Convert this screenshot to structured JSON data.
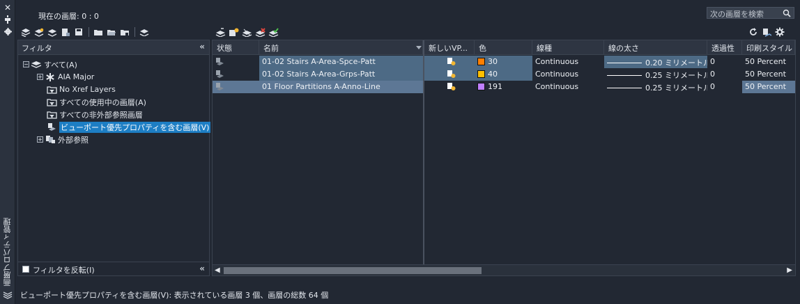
{
  "window": {
    "title": "画層プロパティ管理"
  },
  "header": {
    "current_layer": "現在の画層: 0 : 0",
    "search_placeholder": "次の画層を検索"
  },
  "toolbar_left": [
    "new-property-filter-icon",
    "new-group-filter-icon",
    "layer-states-manager-icon",
    "new-layer-icon",
    "new-vp-freeze-layer-icon",
    "delete-layer-icon",
    "set-current-icon",
    "folder-icon",
    "folder-open-icon",
    "folder-save-icon",
    "settings-layer-icon"
  ],
  "toolbar_right": [
    "refresh-icon",
    "layer-settings-icon",
    "gear-icon"
  ],
  "filter_panel": {
    "title": "フィルタ",
    "tree": [
      {
        "label": "すべて(A)",
        "expander": "−",
        "icon": "layers-stack-icon",
        "level": 0
      },
      {
        "label": "AIA Major",
        "expander": "+",
        "icon": "asterisk-filter-icon",
        "level": 1
      },
      {
        "label": "No Xref Layers",
        "expander": "",
        "icon": "property-filter-icon",
        "level": 1
      },
      {
        "label": "すべての使用中の画層(A)",
        "expander": "",
        "icon": "property-filter-icon",
        "level": 1
      },
      {
        "label": "すべての非外部参照画層",
        "expander": "",
        "icon": "property-filter-icon",
        "level": 1
      },
      {
        "label": "ビューポート優先プロパティを含む画層(V)",
        "expander": "",
        "icon": "viewport-override-icon",
        "level": 1,
        "selected": true
      },
      {
        "label": "外部参照",
        "expander": "+",
        "icon": "xref-icon",
        "level": 1
      }
    ],
    "invert_label": "フィルタを反転(I)"
  },
  "grid": {
    "columns": [
      "状態",
      "名前",
      "新しいVP...",
      "色",
      "線種",
      "線の太さ",
      "透過性",
      "印刷スタイル"
    ],
    "rows": [
      {
        "name": "01-02 Stairs A-Area-Spce-Patt",
        "color_value": "30",
        "color_hex": "#ff7f00",
        "linetype": "Continuous",
        "lineweight": "0.20 ミリメートル",
        "transparency": "0",
        "plot_style": "50 Percent"
      },
      {
        "name": "01-02 Stairs A-Area-Grps-Patt",
        "color_value": "40",
        "color_hex": "#ffbf00",
        "linetype": "Continuous",
        "lineweight": "0.25 ミリメートル",
        "transparency": "0",
        "plot_style": "50 Percent"
      },
      {
        "name": "01 Floor Partitions A-Anno-Line",
        "color_value": "191",
        "color_hex": "#bf7fff",
        "linetype": "Continuous",
        "lineweight": "0.25 ミリメートル",
        "transparency": "0",
        "plot_style": "50 Percent"
      }
    ]
  },
  "status": {
    "text": "ビューポート優先プロパティを含む画層(V): 表示されている画層 3 個、画層の総数 64 個"
  }
}
